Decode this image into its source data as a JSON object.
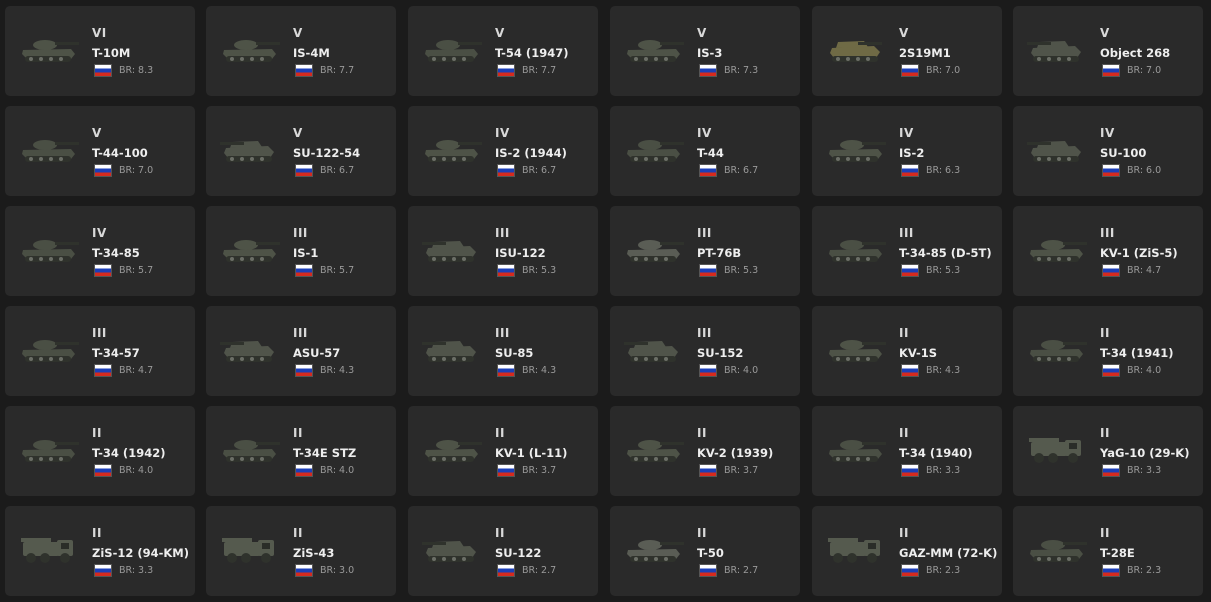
{
  "vehicles": [
    {
      "tier": "VI",
      "name": "T-10M",
      "br": "BR: 8.3",
      "type": "heavy"
    },
    {
      "tier": "V",
      "name": "IS-4M",
      "br": "BR: 7.7",
      "type": "heavy"
    },
    {
      "tier": "V",
      "name": "T-54 (1947)",
      "br": "BR: 7.7",
      "type": "medium"
    },
    {
      "tier": "V",
      "name": "IS-3",
      "br": "BR: 7.3",
      "type": "heavy"
    },
    {
      "tier": "V",
      "name": "2S19M1",
      "br": "BR: 7.0",
      "type": "spg"
    },
    {
      "tier": "V",
      "name": "Object 268",
      "br": "BR: 7.0",
      "type": "td"
    },
    {
      "tier": "V",
      "name": "T-44-100",
      "br": "BR: 7.0",
      "type": "medium"
    },
    {
      "tier": "V",
      "name": "SU-122-54",
      "br": "BR: 6.7",
      "type": "td"
    },
    {
      "tier": "IV",
      "name": "IS-2 (1944)",
      "br": "BR: 6.7",
      "type": "heavy"
    },
    {
      "tier": "IV",
      "name": "T-44",
      "br": "BR: 6.7",
      "type": "medium"
    },
    {
      "tier": "IV",
      "name": "IS-2",
      "br": "BR: 6.3",
      "type": "heavy"
    },
    {
      "tier": "IV",
      "name": "SU-100",
      "br": "BR: 6.0",
      "type": "td"
    },
    {
      "tier": "IV",
      "name": "T-34-85",
      "br": "BR: 5.7",
      "type": "medium"
    },
    {
      "tier": "III",
      "name": "IS-1",
      "br": "BR: 5.7",
      "type": "heavy"
    },
    {
      "tier": "III",
      "name": "ISU-122",
      "br": "BR: 5.3",
      "type": "td"
    },
    {
      "tier": "III",
      "name": "PT-76B",
      "br": "BR: 5.3",
      "type": "light"
    },
    {
      "tier": "III",
      "name": "T-34-85 (D-5T)",
      "br": "BR: 5.3",
      "type": "medium"
    },
    {
      "tier": "III",
      "name": "KV-1 (ZiS-5)",
      "br": "BR: 4.7",
      "type": "heavy"
    },
    {
      "tier": "III",
      "name": "T-34-57",
      "br": "BR: 4.7",
      "type": "medium"
    },
    {
      "tier": "III",
      "name": "ASU-57",
      "br": "BR: 4.3",
      "type": "td"
    },
    {
      "tier": "III",
      "name": "SU-85",
      "br": "BR: 4.3",
      "type": "td"
    },
    {
      "tier": "III",
      "name": "SU-152",
      "br": "BR: 4.0",
      "type": "td"
    },
    {
      "tier": "II",
      "name": "KV-1S",
      "br": "BR: 4.3",
      "type": "heavy"
    },
    {
      "tier": "II",
      "name": "T-34 (1941)",
      "br": "BR: 4.0",
      "type": "medium"
    },
    {
      "tier": "II",
      "name": "T-34 (1942)",
      "br": "BR: 4.0",
      "type": "medium"
    },
    {
      "tier": "II",
      "name": "T-34E STZ",
      "br": "BR: 4.0",
      "type": "medium"
    },
    {
      "tier": "II",
      "name": "KV-1 (L-11)",
      "br": "BR: 3.7",
      "type": "heavy"
    },
    {
      "tier": "II",
      "name": "KV-2 (1939)",
      "br": "BR: 3.7",
      "type": "heavy"
    },
    {
      "tier": "II",
      "name": "T-34 (1940)",
      "br": "BR: 3.3",
      "type": "medium"
    },
    {
      "tier": "II",
      "name": "YaG-10 (29-K)",
      "br": "BR: 3.3",
      "type": "truck"
    },
    {
      "tier": "II",
      "name": "ZiS-12 (94-KM)",
      "br": "BR: 3.3",
      "type": "truck"
    },
    {
      "tier": "II",
      "name": "ZiS-43",
      "br": "BR: 3.0",
      "type": "truck"
    },
    {
      "tier": "II",
      "name": "SU-122",
      "br": "BR: 2.7",
      "type": "td"
    },
    {
      "tier": "II",
      "name": "T-50",
      "br": "BR: 2.7",
      "type": "light"
    },
    {
      "tier": "II",
      "name": "GAZ-MM (72-K)",
      "br": "BR: 2.3",
      "type": "truck"
    },
    {
      "tier": "II",
      "name": "T-28E",
      "br": "BR: 2.3",
      "type": "medium"
    }
  ],
  "flag_icon": "russia-flag-icon",
  "colors": {
    "background": "#1b1b1b",
    "card": "#2a2a2a",
    "tier_text": "#d9d9d9",
    "name_text": "#eeeeee",
    "br_text": "#9a9a9a",
    "flag_white": "#ffffff",
    "flag_blue": "#1c3fb8",
    "flag_red": "#d52b1e"
  }
}
